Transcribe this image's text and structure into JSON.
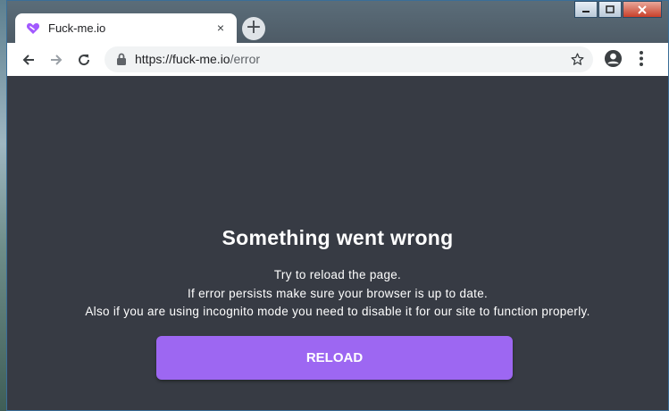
{
  "browser": {
    "tab_title": "Fuck-me.io",
    "url_host": "https://fuck-me.io",
    "url_path": "/error",
    "new_tab_glyph": "+",
    "tab_close_glyph": "×"
  },
  "icons": {
    "favicon": "heart-logo-icon",
    "back": "back-arrow-icon",
    "forward": "forward-arrow-icon",
    "reload": "reload-icon",
    "lock": "lock-icon",
    "bookmark": "star-icon",
    "profile": "profile-icon",
    "menu": "kebab-menu-icon"
  },
  "page": {
    "heading": "Something went wrong",
    "lines": [
      "Try to reload the page.",
      "If error persists make sure your browser is up to date.",
      "Also if you are using incognito mode you need to disable it for our site to function properly."
    ],
    "reload_label": "RELOAD"
  },
  "colors": {
    "page_background": "#373b44",
    "button": "#9d67f2",
    "favicon": "#a259ff"
  }
}
